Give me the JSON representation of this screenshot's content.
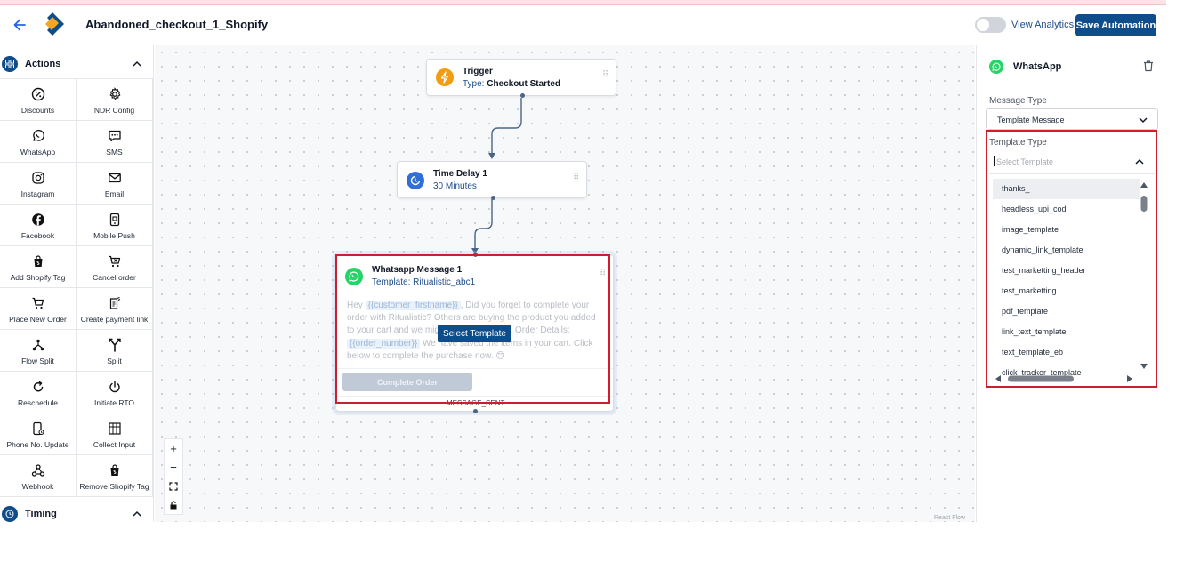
{
  "header": {
    "title": "Abandoned_checkout_1_Shopify",
    "view_analytics": "View Analytics",
    "save_label": "Save Automation"
  },
  "sidebar": {
    "section_actions": "Actions",
    "section_timing": "Timing",
    "actions": [
      {
        "label": "Discounts",
        "icon": "percent-icon"
      },
      {
        "label": "NDR Config",
        "icon": "gear-icon"
      },
      {
        "label": "WhatsApp",
        "icon": "whatsapp-icon"
      },
      {
        "label": "SMS",
        "icon": "sms-icon"
      },
      {
        "label": "Instagram",
        "icon": "instagram-icon"
      },
      {
        "label": "Email",
        "icon": "email-icon"
      },
      {
        "label": "Facebook",
        "icon": "facebook-icon"
      },
      {
        "label": "Mobile Push",
        "icon": "mobile-push-icon"
      },
      {
        "label": "Add Shopify Tag",
        "icon": "shopify-bag-icon"
      },
      {
        "label": "Cancel order",
        "icon": "cart-cancel-icon"
      },
      {
        "label": "Place New Order",
        "icon": "cart-icon"
      },
      {
        "label": "Create payment link",
        "icon": "payment-link-icon"
      },
      {
        "label": "Flow Split",
        "icon": "flow-split-icon"
      },
      {
        "label": "Split",
        "icon": "split-icon"
      },
      {
        "label": "Reschedule",
        "icon": "reschedule-icon"
      },
      {
        "label": "Initiate RTO",
        "icon": "power-icon"
      },
      {
        "label": "Phone No. Update",
        "icon": "phone-update-icon"
      },
      {
        "label": "Collect Input",
        "icon": "collect-input-icon"
      },
      {
        "label": "Webhook",
        "icon": "webhook-icon"
      },
      {
        "label": "Remove Shopify Tag",
        "icon": "shopify-bag-icon"
      }
    ]
  },
  "canvas": {
    "trigger": {
      "title": "Trigger",
      "type_label": "Type:",
      "type_value": "Checkout Started"
    },
    "delay": {
      "title": "Time Delay 1",
      "value": "30 Minutes"
    },
    "whatsapp": {
      "title": "Whatsapp Message 1",
      "template_line": "Template: Ritualistic_abc1",
      "body_1": "Hey ",
      "var_1": "{{customer_firstname}}",
      "body_2": ", Did you forget to complete your order with Ritualistic? Others are buying the product you added to your cart and we might run out of stock. Order Details: ",
      "var_2": "{{order_number}}",
      "body_3": " We have saved the items in your cart. Click below to complete the purchase now. 😊",
      "select_template": "Select Template",
      "complete_order": "Complete Order",
      "status": "MESSAGE_SENT"
    },
    "zoom": {
      "plus": "+",
      "minus": "−"
    },
    "attribution": "React Flow"
  },
  "right_panel": {
    "title": "WhatsApp",
    "message_type_label": "Message Type",
    "message_type_value": "Template Message",
    "template_type_label": "Template Type",
    "template_placeholder": "Select Template",
    "templates": [
      "thanks_",
      "headless_upi_cod",
      "image_template",
      "dynamic_link_template",
      "test_marketting_header",
      "test_marketting",
      "pdf_template",
      "link_text_template",
      "text_template_eb",
      "click_tracker_template"
    ]
  },
  "colors": {
    "brand": "#0f4c8a",
    "link": "#1e4e8c",
    "highlight_box": "#cc1f2d",
    "trigger_icon": "#f39c12",
    "whatsapp_green": "#25d366"
  }
}
